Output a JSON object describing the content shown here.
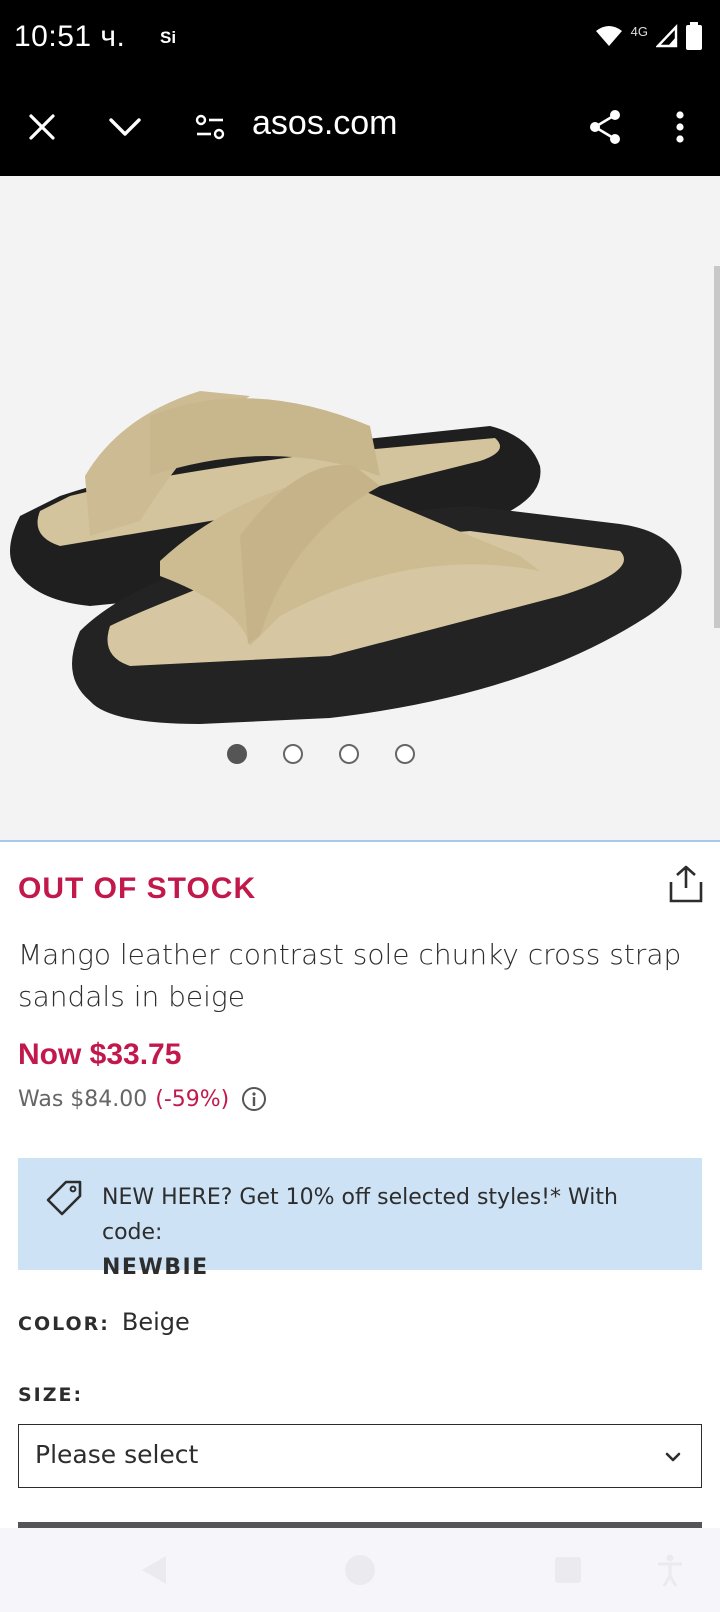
{
  "status_bar": {
    "time": "10:51 ч.",
    "carrier_icon_text": "Si",
    "network": "4G",
    "icons": [
      "wifi-icon",
      "signal-icon",
      "battery-icon"
    ]
  },
  "browser": {
    "url": "asos.com",
    "icons": [
      "close-icon",
      "chevron-down-icon",
      "site-settings-icon",
      "share-icon",
      "more-vert-icon"
    ]
  },
  "carousel": {
    "image_count": 4,
    "active_index": 0
  },
  "product": {
    "stock_status": "OUT OF STOCK",
    "title": "Mango leather contrast sole chunky cross strap sandals in beige",
    "now_price": "Now $33.75",
    "was_price": "Was $84.00",
    "discount": "(-59%)"
  },
  "promo": {
    "text": "NEW HERE? Get 10% off selected styles!* With code:",
    "code": "NEWBIE"
  },
  "color": {
    "label": "COLOR:",
    "value": "Beige"
  },
  "size": {
    "label": "SIZE:",
    "placeholder": "Please select"
  },
  "colors": {
    "accent_red": "#c1194c",
    "promo_bg": "#cde2f5",
    "text": "#2d2d2d"
  }
}
